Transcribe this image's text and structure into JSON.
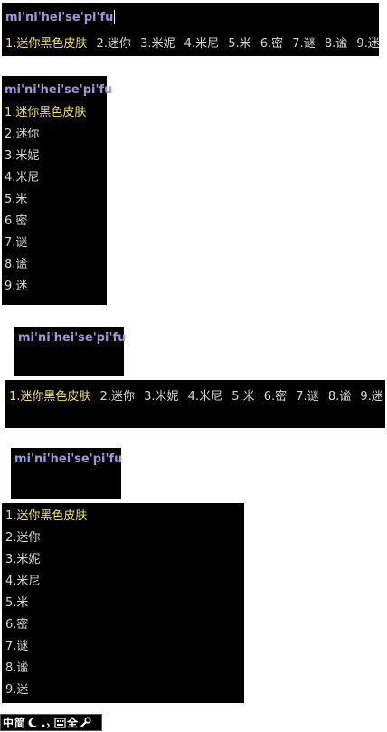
{
  "pinyin": "mi'ni'hei'se'pi'fu",
  "candidates": [
    {
      "label": "1.迷你黑色皮肤"
    },
    {
      "label": "2.迷你"
    },
    {
      "label": "3.米妮"
    },
    {
      "label": "4.米尼"
    },
    {
      "label": "5.米"
    },
    {
      "label": "6.密"
    },
    {
      "label": "7.谜"
    },
    {
      "label": "8.谧"
    },
    {
      "label": "9.迷"
    }
  ],
  "status_bar": {
    "mode_label": "中",
    "charset_label": "简",
    "moon_icon": "crescent-moon-icon",
    "punct_icon": "punctuation-icon",
    "softkbd_icon": "soft-keyboard-icon",
    "width_label": "全",
    "tools_icon": "wrench-icon"
  },
  "colors": {
    "background": "#000000",
    "pinyin": "#9a9ad6",
    "selected": "#f1e25f",
    "text": "#d8d8d8"
  }
}
